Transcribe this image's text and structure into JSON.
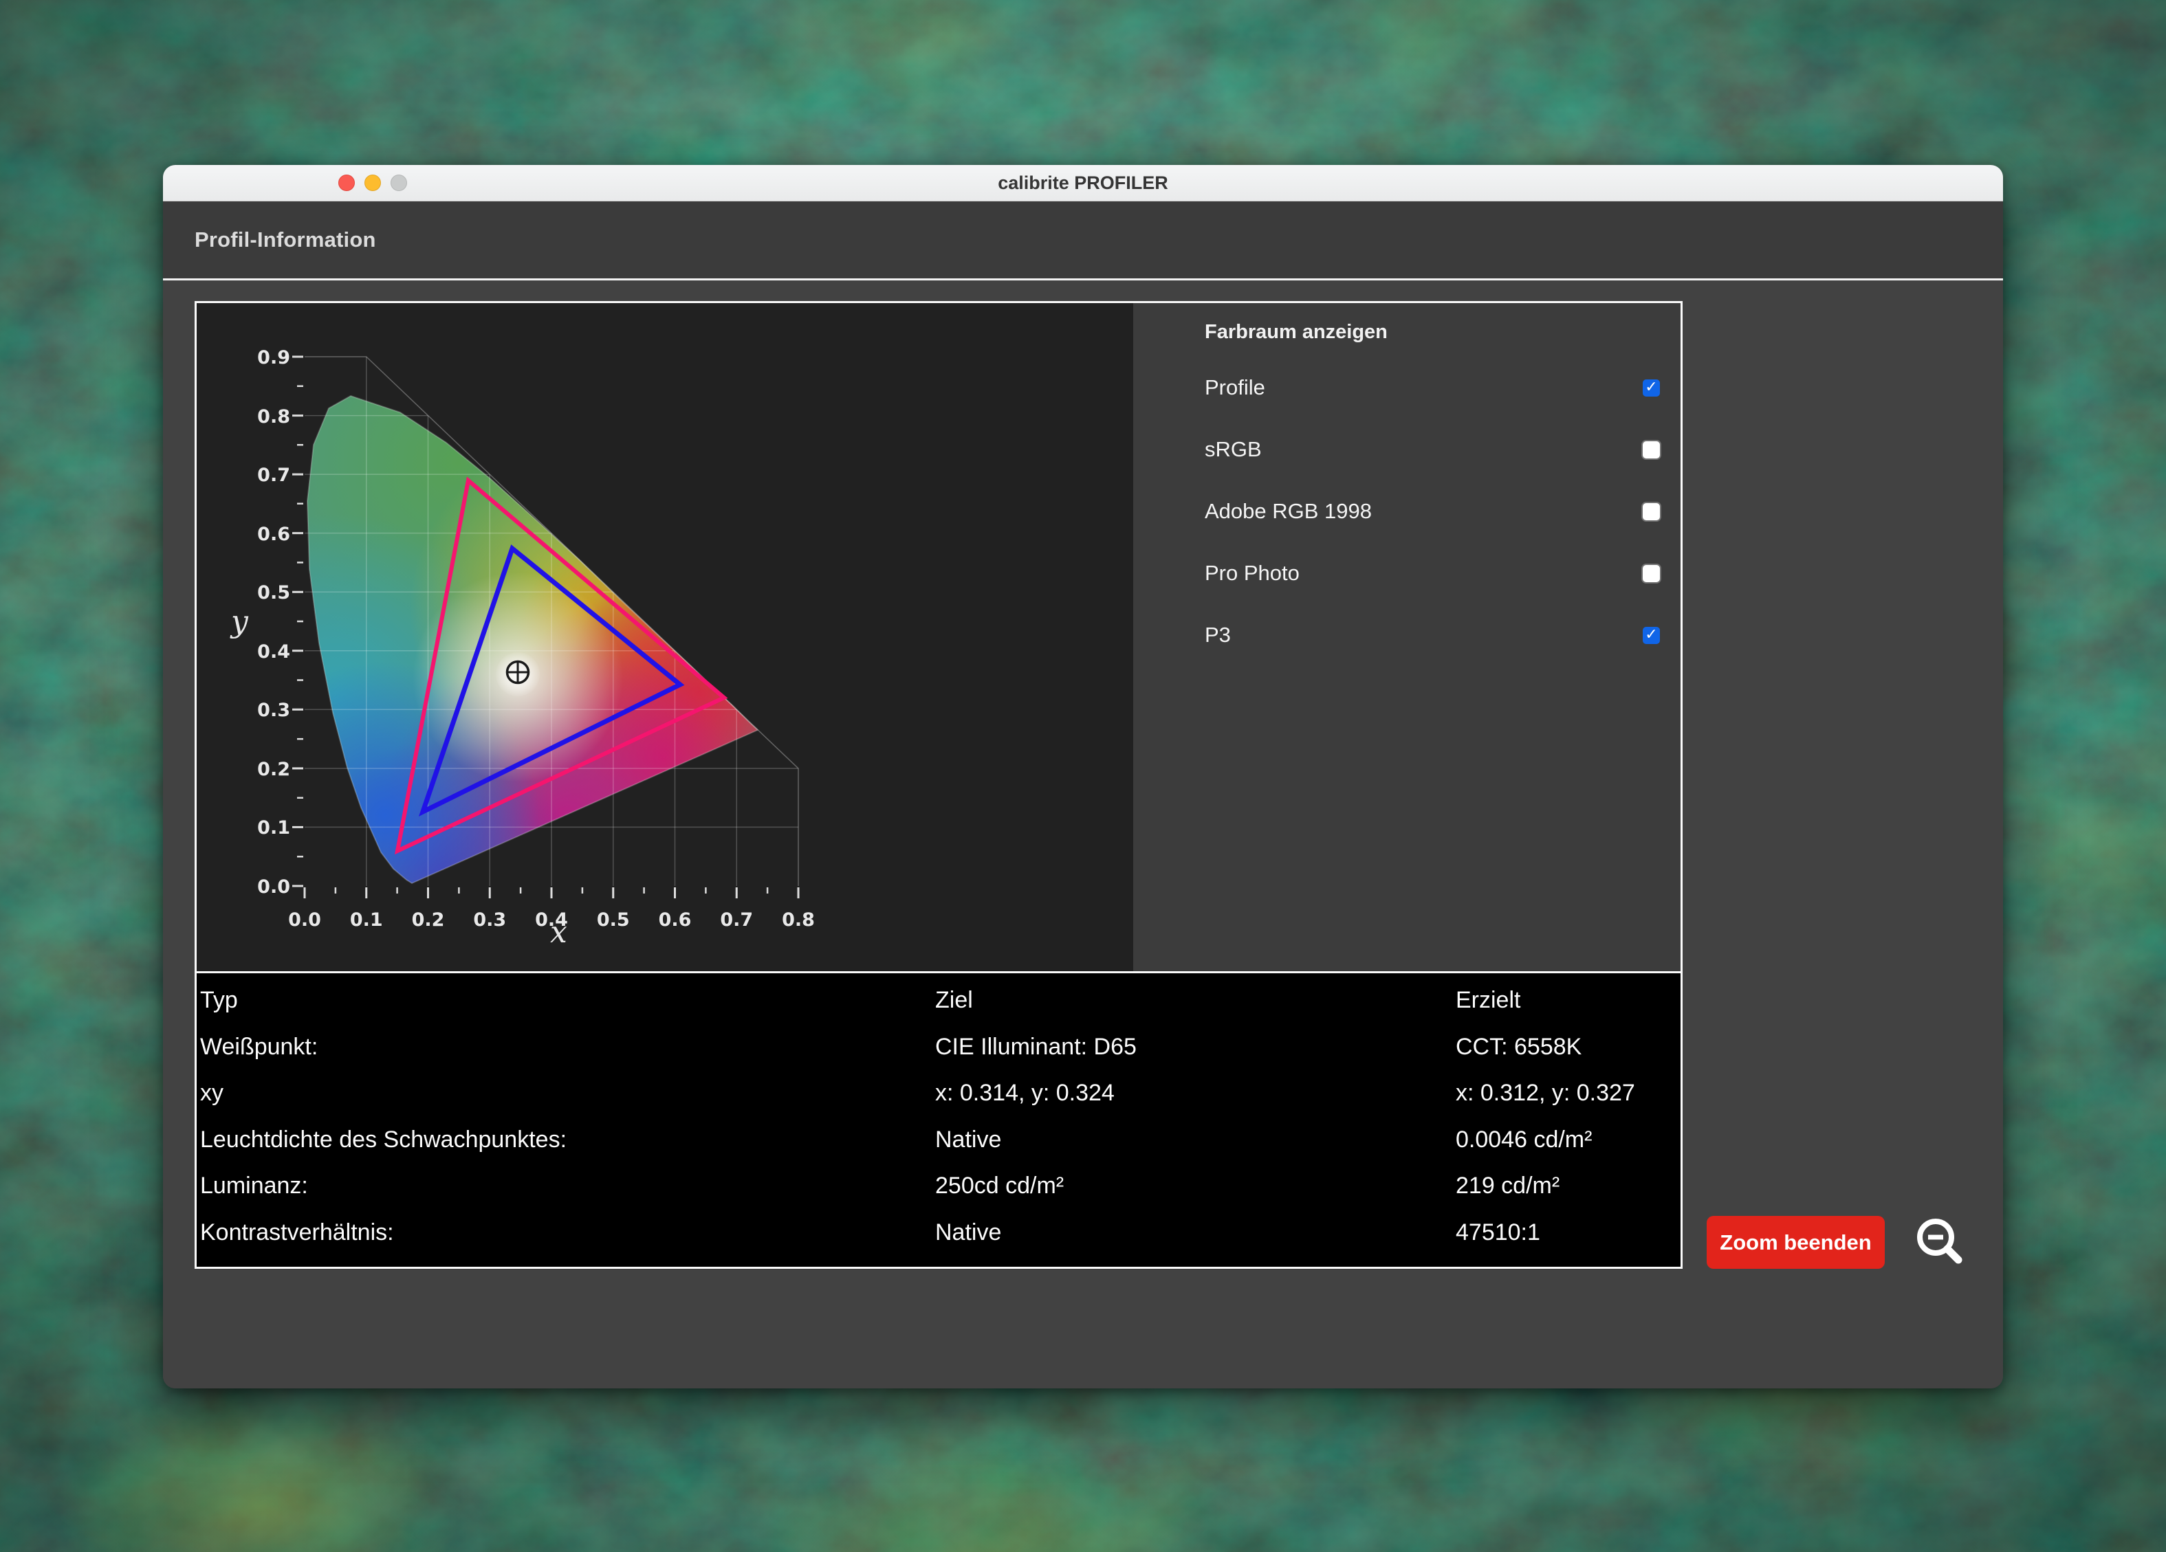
{
  "window": {
    "title": "calibrite PROFILER",
    "header": "Profil-Information"
  },
  "gamut_panel": {
    "title": "Farbraum anzeigen",
    "items": [
      {
        "label": "Profile",
        "checked": true
      },
      {
        "label": "sRGB",
        "checked": false
      },
      {
        "label": "Adobe RGB 1998",
        "checked": false
      },
      {
        "label": "Pro Photo",
        "checked": false
      },
      {
        "label": "P3",
        "checked": true
      }
    ]
  },
  "chart_data": {
    "type": "chromaticity-gamut-diagram",
    "title": "CIE 1931 xy chromaticity diagram with gamut triangles",
    "xlabel": "x",
    "ylabel": "y",
    "xlim": [
      0.0,
      0.8
    ],
    "ylim": [
      0.0,
      0.9
    ],
    "grid": true,
    "x_tick_labels": [
      "0.0",
      "0.1",
      "0.2",
      "0.3",
      "0.4",
      "0.5",
      "0.6",
      "0.7",
      "0.8"
    ],
    "y_tick_labels": [
      "0.0",
      "0.1",
      "0.2",
      "0.3",
      "0.4",
      "0.5",
      "0.6",
      "0.7",
      "0.8",
      "0.9"
    ],
    "series": [
      {
        "name": "P3",
        "color": "#f5156e",
        "shape": "gamut-triangle",
        "vertices_xy": [
          [
            0.68,
            0.32
          ],
          [
            0.265,
            0.69
          ],
          [
            0.15,
            0.06
          ]
        ]
      },
      {
        "name": "Profile",
        "color": "#2012e6",
        "shape": "gamut-triangle",
        "vertices_xy": [
          [
            0.608,
            0.342
          ],
          [
            0.34,
            0.573
          ],
          [
            0.192,
            0.126
          ]
        ]
      }
    ],
    "white_point_marker_xy": [
      0.35,
      0.357
    ]
  },
  "table": {
    "columns": [
      "Typ",
      "Ziel",
      "Erzielt"
    ],
    "rows": [
      [
        "Weißpunkt:",
        "CIE Illuminant: D65",
        "CCT: 6558K"
      ],
      [
        "xy",
        "x: 0.314, y: 0.324",
        "x: 0.312, y: 0.327"
      ],
      [
        "Leuchtdichte des Schwachpunktes:",
        "Native",
        "0.0046 cd/m²"
      ],
      [
        "Luminanz:",
        "250cd cd/m²",
        "219 cd/m²"
      ],
      [
        "Kontrastverhältnis:",
        "Native",
        "47510:1"
      ]
    ]
  },
  "actions": {
    "zoom_button": "Zoom beenden"
  },
  "colors": {
    "accent_red": "#e2241b",
    "checkbox_blue": "#1065e8",
    "p3_pink": "#f5156e",
    "profile_blue": "#2012e6",
    "window_body": "#424242",
    "chart_bg": "#212121",
    "table_bg": "#000000"
  }
}
